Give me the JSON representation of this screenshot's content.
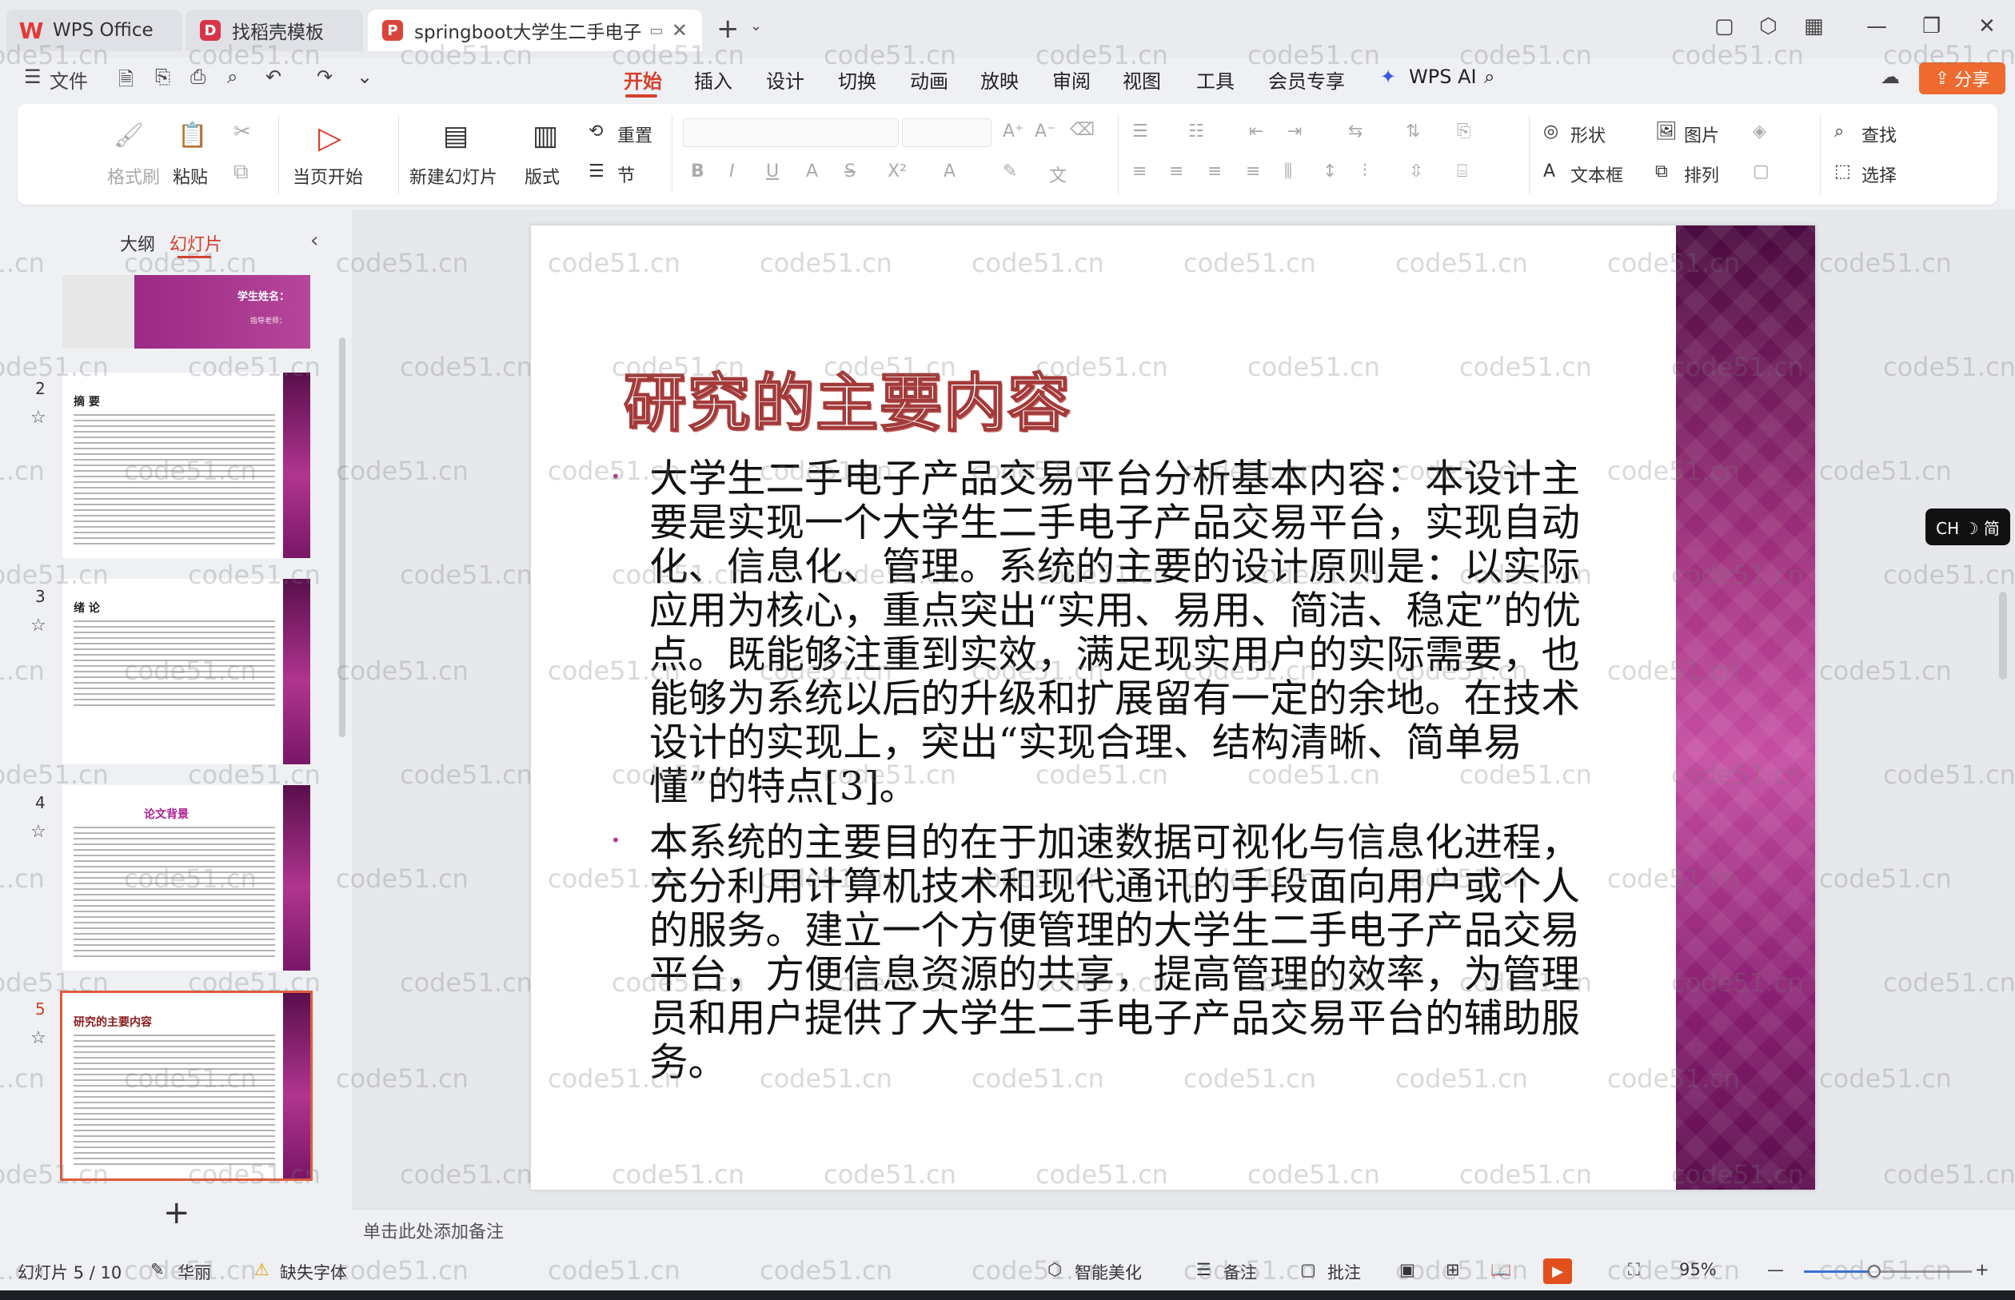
{
  "titlebar": {
    "tabs": [
      {
        "label": "WPS Office"
      },
      {
        "label": "找稻壳模板"
      },
      {
        "label": "springboot大学生二手电子"
      }
    ]
  },
  "menu": {
    "file": "文件",
    "items": [
      "开始",
      "插入",
      "设计",
      "切换",
      "动画",
      "放映",
      "审阅",
      "视图",
      "工具",
      "会员专享"
    ],
    "active": "开始",
    "wps_ai": "WPS AI",
    "share": "分享"
  },
  "ribbon": {
    "format_painter": "格式刷",
    "paste": "粘贴",
    "play_from_current": "当页开始",
    "new_slide": "新建幻灯片",
    "layout": "版式",
    "reset": "重置",
    "section": "节",
    "shape": "形状",
    "picture": "图片",
    "find": "查找",
    "textbox": "文本框",
    "arrange": "排列",
    "select": "选择"
  },
  "left_pane": {
    "tab_outline": "大纲",
    "tab_slides": "幻灯片",
    "thumbnails": [
      {
        "num": "",
        "title": "学生姓名：",
        "subtitle": "指导老师："
      },
      {
        "num": "2",
        "title": "摘  要"
      },
      {
        "num": "3",
        "title": "绪  论"
      },
      {
        "num": "4",
        "title": "论文背景"
      },
      {
        "num": "5",
        "title": "研究的主要内容"
      }
    ]
  },
  "slide": {
    "title": "研究的主要内容",
    "bullets": [
      "大学生二手电子产品交易平台分析基本内容：本设计主要是实现一个大学生二手电子产品交易平台，实现自动化、信息化、管理。系统的主要的设计原则是：以实际应用为核心，重点突出“实用、易用、简洁、稳定”的优点。既能够注重到实效，满足现实用户的实际需要，也能够为系统以后的升级和扩展留有一定的余地。在技术设计的实现上，突出“实现合理、结构清晰、简单易懂”的特点[3]。",
      "本系统的主要目的在于加速数据可视化与信息化进程，充分利用计算机技术和现代通讯的手段面向用户或个人的服务。建立一个方便管理的大学生二手电子产品交易平台，方便信息资源的共享，提高管理的效率，为管理员和用户提供了大学生二手电子产品交易平台的辅助服务。"
    ]
  },
  "notes_placeholder": "单击此处添加备注",
  "ime": "CH ☽ 简",
  "statusbar": {
    "slide_counter": "幻灯片 5 / 10",
    "theme": "华丽",
    "missing_font": "缺失字体",
    "beautify": "智能美化",
    "notes": "备注",
    "comments": "批注",
    "zoom": "95%",
    "zoom_fraction": 0.42
  },
  "watermark": "code51.cn",
  "colors": {
    "accent": "#d4402c",
    "slide_band": "#a2307f"
  }
}
